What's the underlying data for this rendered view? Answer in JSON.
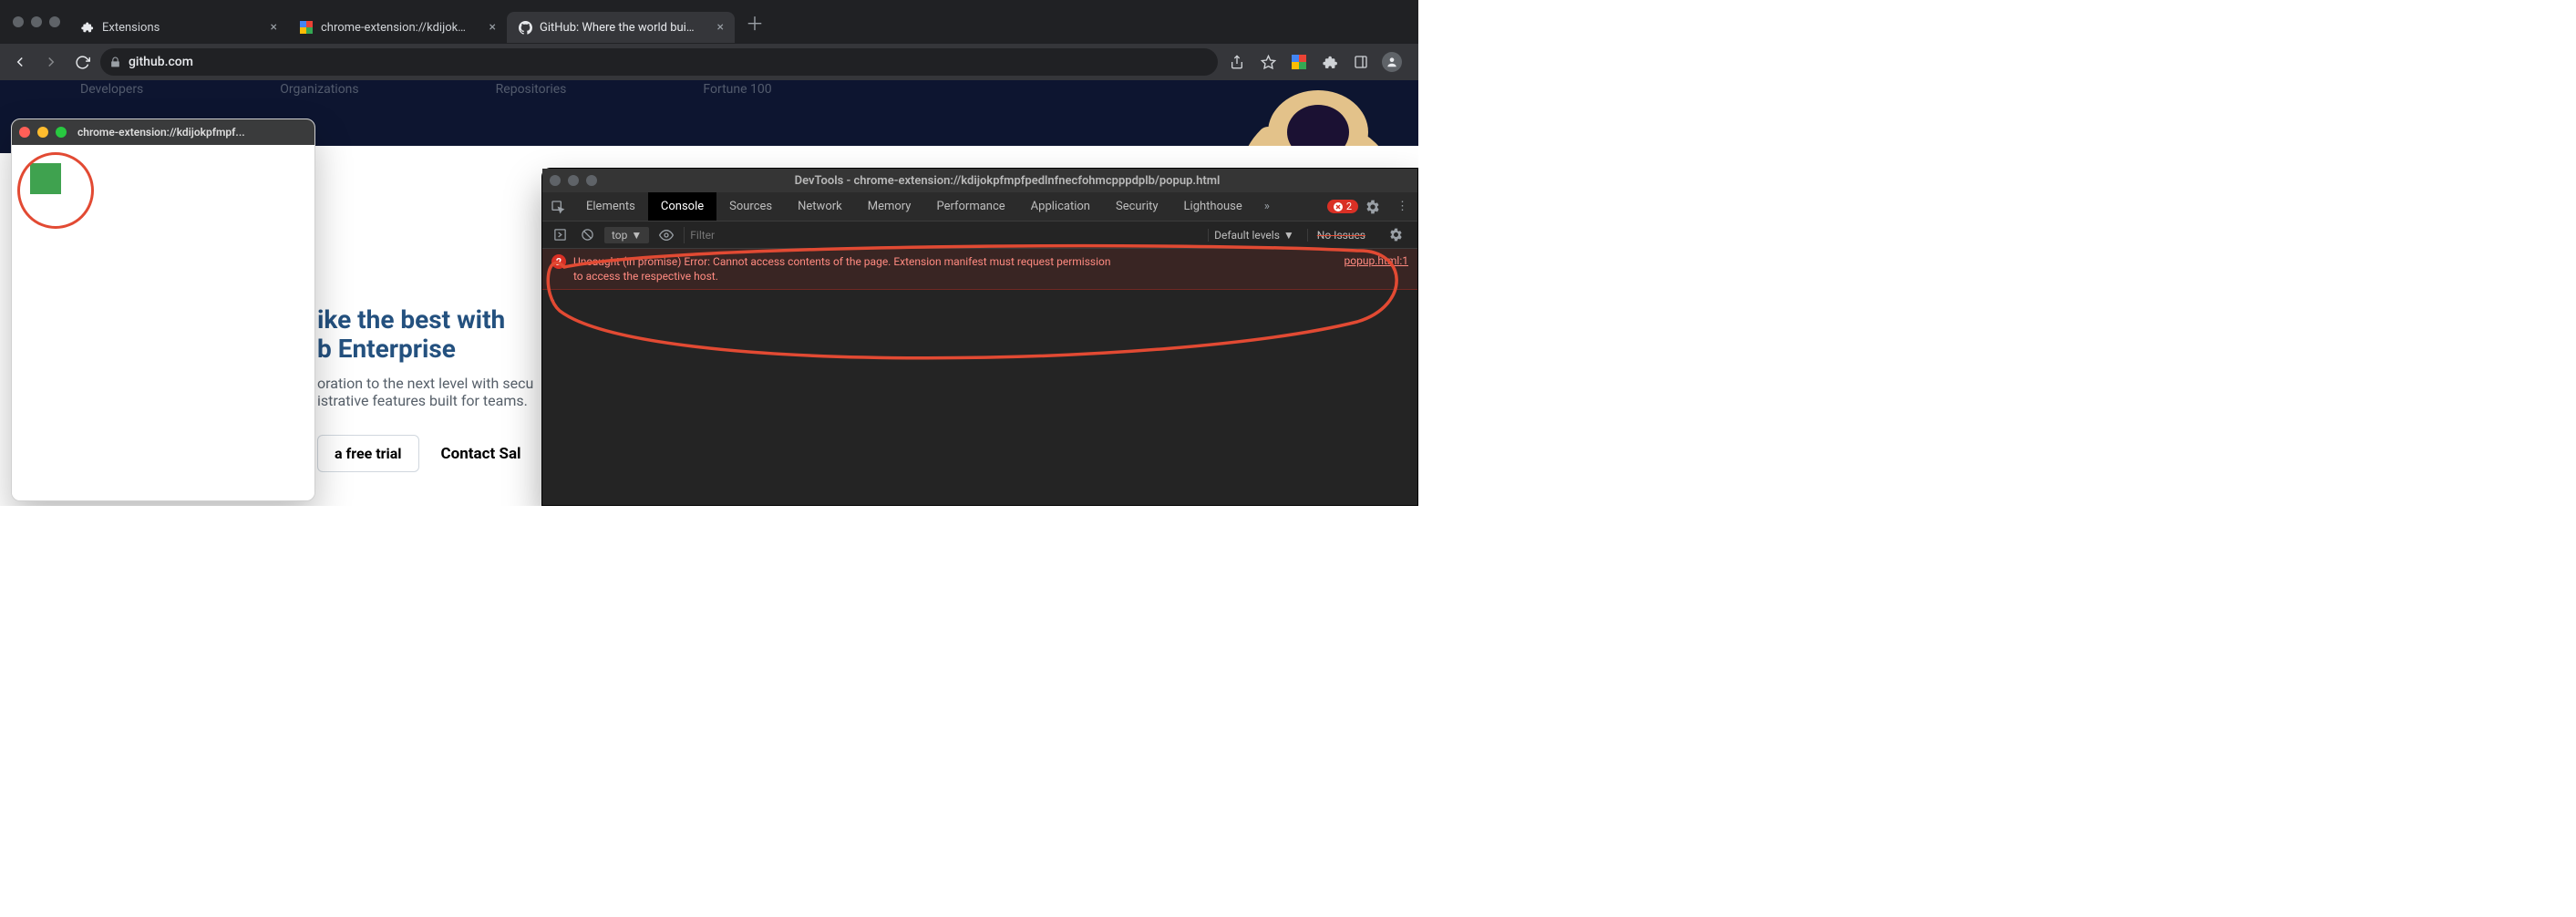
{
  "browser": {
    "tabs": [
      {
        "label": "Extensions",
        "favicon": "puzzle"
      },
      {
        "label": "chrome-extension://kdijokpfmp",
        "favicon": "color-sq"
      },
      {
        "label": "GitHub: Where the world builds",
        "favicon": "github"
      }
    ],
    "active_tab_index": 2,
    "address": "github.com"
  },
  "github": {
    "nav_items": [
      "Developers",
      "Organizations",
      "Repositories",
      "Fortune 100"
    ],
    "heading_l1": "ike the best with",
    "heading_l2": "b Enterprise",
    "para_l1": "oration to the next level with secu",
    "para_l2": "istrative features built for teams.",
    "trial_btn": "a free trial",
    "contact_link": "Contact Sal"
  },
  "popup": {
    "title": "chrome-extension://kdijokpfmpf..."
  },
  "devtools": {
    "window_title": "DevTools - chrome-extension://kdijokpfmpfpedlnfnecfohmcpppdplb/popup.html",
    "tabs": [
      "Elements",
      "Console",
      "Sources",
      "Network",
      "Memory",
      "Performance",
      "Application",
      "Security",
      "Lighthouse"
    ],
    "active_tab": "Console",
    "error_count": "2",
    "console": {
      "context": "top",
      "filter_placeholder": "Filter",
      "levels_label": "Default levels",
      "issues_label": "No Issues",
      "error_badge": "2",
      "error_text": "Uncaught (in promise) Error: Cannot access contents of the page. Extension manifest must request permission\nto access the respective host.",
      "error_source": "popup.html:1"
    }
  }
}
